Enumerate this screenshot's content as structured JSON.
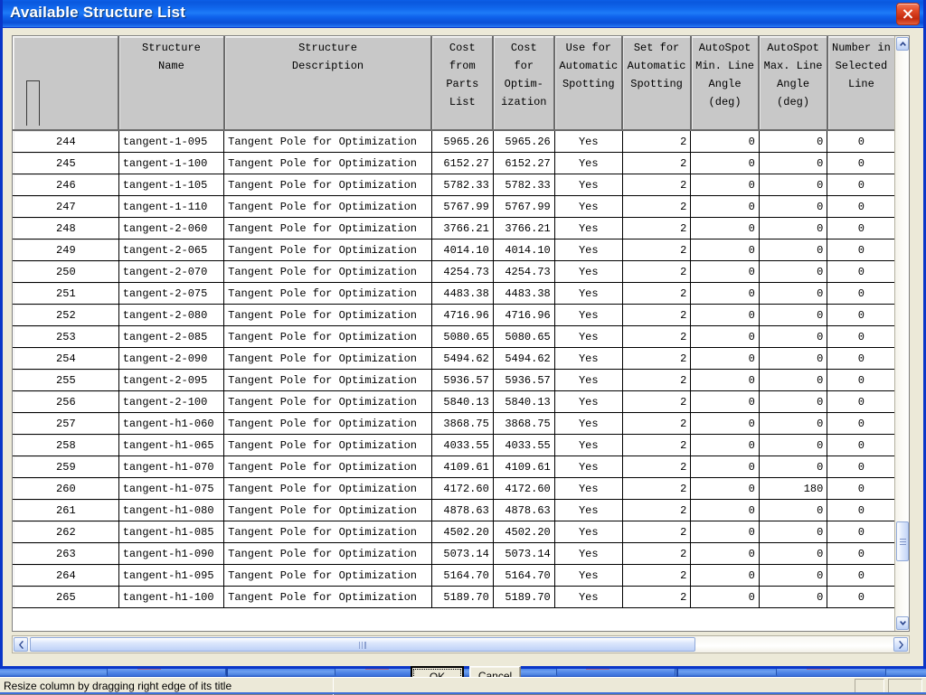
{
  "window": {
    "title": "Available Structure List",
    "close_icon": "close-icon"
  },
  "grid": {
    "headers": [
      {
        "id": "row-number",
        "label": ""
      },
      {
        "id": "structure-name",
        "label": "Structure\nName"
      },
      {
        "id": "structure-description",
        "label": "Structure\nDescription"
      },
      {
        "id": "cost-from-parts-list",
        "label": "Cost\nfrom\nParts\nList"
      },
      {
        "id": "cost-for-optimization",
        "label": "Cost\nfor\nOptim-\nization"
      },
      {
        "id": "use-for-automatic-spotting",
        "label": "Use for\nAutomatic\nSpotting"
      },
      {
        "id": "set-for-automatic-spotting",
        "label": "Set for\nAutomatic\nSpotting"
      },
      {
        "id": "autospot-min-line-angle",
        "label": "AutoSpot\nMin. Line\nAngle\n(deg)"
      },
      {
        "id": "autospot-max-line-angle",
        "label": "AutoSpot\nMax. Line\nAngle\n(deg)"
      },
      {
        "id": "number-in-selected-line",
        "label": "Number in\nSelected\nLine"
      }
    ],
    "rows": [
      {
        "num": "244",
        "name": "tangent-1-095",
        "desc": "Tangent Pole for Optimization",
        "cost_parts": "5965.26",
        "cost_opt": "5965.26",
        "use_auto": "Yes",
        "set_auto": "2",
        "min_angle": "0",
        "max_angle": "0",
        "num_sel": "0"
      },
      {
        "num": "245",
        "name": "tangent-1-100",
        "desc": "Tangent Pole for Optimization",
        "cost_parts": "6152.27",
        "cost_opt": "6152.27",
        "use_auto": "Yes",
        "set_auto": "2",
        "min_angle": "0",
        "max_angle": "0",
        "num_sel": "0"
      },
      {
        "num": "246",
        "name": "tangent-1-105",
        "desc": "Tangent Pole for Optimization",
        "cost_parts": "5782.33",
        "cost_opt": "5782.33",
        "use_auto": "Yes",
        "set_auto": "2",
        "min_angle": "0",
        "max_angle": "0",
        "num_sel": "0"
      },
      {
        "num": "247",
        "name": "tangent-1-110",
        "desc": "Tangent Pole for Optimization",
        "cost_parts": "5767.99",
        "cost_opt": "5767.99",
        "use_auto": "Yes",
        "set_auto": "2",
        "min_angle": "0",
        "max_angle": "0",
        "num_sel": "0"
      },
      {
        "num": "248",
        "name": "tangent-2-060",
        "desc": "Tangent Pole for Optimization",
        "cost_parts": "3766.21",
        "cost_opt": "3766.21",
        "use_auto": "Yes",
        "set_auto": "2",
        "min_angle": "0",
        "max_angle": "0",
        "num_sel": "0"
      },
      {
        "num": "249",
        "name": "tangent-2-065",
        "desc": "Tangent Pole for Optimization",
        "cost_parts": "4014.10",
        "cost_opt": "4014.10",
        "use_auto": "Yes",
        "set_auto": "2",
        "min_angle": "0",
        "max_angle": "0",
        "num_sel": "0"
      },
      {
        "num": "250",
        "name": "tangent-2-070",
        "desc": "Tangent Pole for Optimization",
        "cost_parts": "4254.73",
        "cost_opt": "4254.73",
        "use_auto": "Yes",
        "set_auto": "2",
        "min_angle": "0",
        "max_angle": "0",
        "num_sel": "0"
      },
      {
        "num": "251",
        "name": "tangent-2-075",
        "desc": "Tangent Pole for Optimization",
        "cost_parts": "4483.38",
        "cost_opt": "4483.38",
        "use_auto": "Yes",
        "set_auto": "2",
        "min_angle": "0",
        "max_angle": "0",
        "num_sel": "0"
      },
      {
        "num": "252",
        "name": "tangent-2-080",
        "desc": "Tangent Pole for Optimization",
        "cost_parts": "4716.96",
        "cost_opt": "4716.96",
        "use_auto": "Yes",
        "set_auto": "2",
        "min_angle": "0",
        "max_angle": "0",
        "num_sel": "0"
      },
      {
        "num": "253",
        "name": "tangent-2-085",
        "desc": "Tangent Pole for Optimization",
        "cost_parts": "5080.65",
        "cost_opt": "5080.65",
        "use_auto": "Yes",
        "set_auto": "2",
        "min_angle": "0",
        "max_angle": "0",
        "num_sel": "0"
      },
      {
        "num": "254",
        "name": "tangent-2-090",
        "desc": "Tangent Pole for Optimization",
        "cost_parts": "5494.62",
        "cost_opt": "5494.62",
        "use_auto": "Yes",
        "set_auto": "2",
        "min_angle": "0",
        "max_angle": "0",
        "num_sel": "0"
      },
      {
        "num": "255",
        "name": "tangent-2-095",
        "desc": "Tangent Pole for Optimization",
        "cost_parts": "5936.57",
        "cost_opt": "5936.57",
        "use_auto": "Yes",
        "set_auto": "2",
        "min_angle": "0",
        "max_angle": "0",
        "num_sel": "0"
      },
      {
        "num": "256",
        "name": "tangent-2-100",
        "desc": "Tangent Pole for Optimization",
        "cost_parts": "5840.13",
        "cost_opt": "5840.13",
        "use_auto": "Yes",
        "set_auto": "2",
        "min_angle": "0",
        "max_angle": "0",
        "num_sel": "0"
      },
      {
        "num": "257",
        "name": "tangent-h1-060",
        "desc": "Tangent Pole for Optimization",
        "cost_parts": "3868.75",
        "cost_opt": "3868.75",
        "use_auto": "Yes",
        "set_auto": "2",
        "min_angle": "0",
        "max_angle": "0",
        "num_sel": "0"
      },
      {
        "num": "258",
        "name": "tangent-h1-065",
        "desc": "Tangent Pole for Optimization",
        "cost_parts": "4033.55",
        "cost_opt": "4033.55",
        "use_auto": "Yes",
        "set_auto": "2",
        "min_angle": "0",
        "max_angle": "0",
        "num_sel": "0"
      },
      {
        "num": "259",
        "name": "tangent-h1-070",
        "desc": "Tangent Pole for Optimization",
        "cost_parts": "4109.61",
        "cost_opt": "4109.61",
        "use_auto": "Yes",
        "set_auto": "2",
        "min_angle": "0",
        "max_angle": "0",
        "num_sel": "0"
      },
      {
        "num": "260",
        "name": "tangent-h1-075",
        "desc": "Tangent Pole for Optimization",
        "cost_parts": "4172.60",
        "cost_opt": "4172.60",
        "use_auto": "Yes",
        "set_auto": "2",
        "min_angle": "0",
        "max_angle": "180",
        "num_sel": "0"
      },
      {
        "num": "261",
        "name": "tangent-h1-080",
        "desc": "Tangent Pole for Optimization",
        "cost_parts": "4878.63",
        "cost_opt": "4878.63",
        "use_auto": "Yes",
        "set_auto": "2",
        "min_angle": "0",
        "max_angle": "0",
        "num_sel": "0"
      },
      {
        "num": "262",
        "name": "tangent-h1-085",
        "desc": "Tangent Pole for Optimization",
        "cost_parts": "4502.20",
        "cost_opt": "4502.20",
        "use_auto": "Yes",
        "set_auto": "2",
        "min_angle": "0",
        "max_angle": "0",
        "num_sel": "0"
      },
      {
        "num": "263",
        "name": "tangent-h1-090",
        "desc": "Tangent Pole for Optimization",
        "cost_parts": "5073.14",
        "cost_opt": "5073.14",
        "use_auto": "Yes",
        "set_auto": "2",
        "min_angle": "0",
        "max_angle": "0",
        "num_sel": "0"
      },
      {
        "num": "264",
        "name": "tangent-h1-095",
        "desc": "Tangent Pole for Optimization",
        "cost_parts": "5164.70",
        "cost_opt": "5164.70",
        "use_auto": "Yes",
        "set_auto": "2",
        "min_angle": "0",
        "max_angle": "0",
        "num_sel": "0"
      },
      {
        "num": "265",
        "name": "tangent-h1-100",
        "desc": "Tangent Pole for Optimization",
        "cost_parts": "5189.70",
        "cost_opt": "5189.70",
        "use_auto": "Yes",
        "set_auto": "2",
        "min_angle": "0",
        "max_angle": "0",
        "num_sel": "0"
      }
    ]
  },
  "scrollbars": {
    "vertical": {
      "up_icon": "chevron-up-icon",
      "down_icon": "chevron-down-icon",
      "thumb_icon": "scroll-thumb-grip"
    },
    "horizontal": {
      "left_icon": "chevron-left-icon",
      "right_icon": "chevron-right-icon",
      "thumb_icon": "scroll-thumb-grip"
    }
  },
  "buttons": {
    "ok": {
      "accel": "O",
      "rest": "K"
    },
    "cancel": {
      "accel": "C",
      "rest": "ancel"
    }
  },
  "statusbar": {
    "message": "Resize column by dragging right edge of its title"
  },
  "colors": {
    "titlebar_blue": "#1169ee",
    "window_border": "#0a36c8",
    "close_red": "#c3290c",
    "face": "#ece9d8",
    "grid_shaded": "#c8c8c8",
    "grid_header": "#c8c8c8",
    "scrollbar_blue": "#bcd0f6"
  }
}
